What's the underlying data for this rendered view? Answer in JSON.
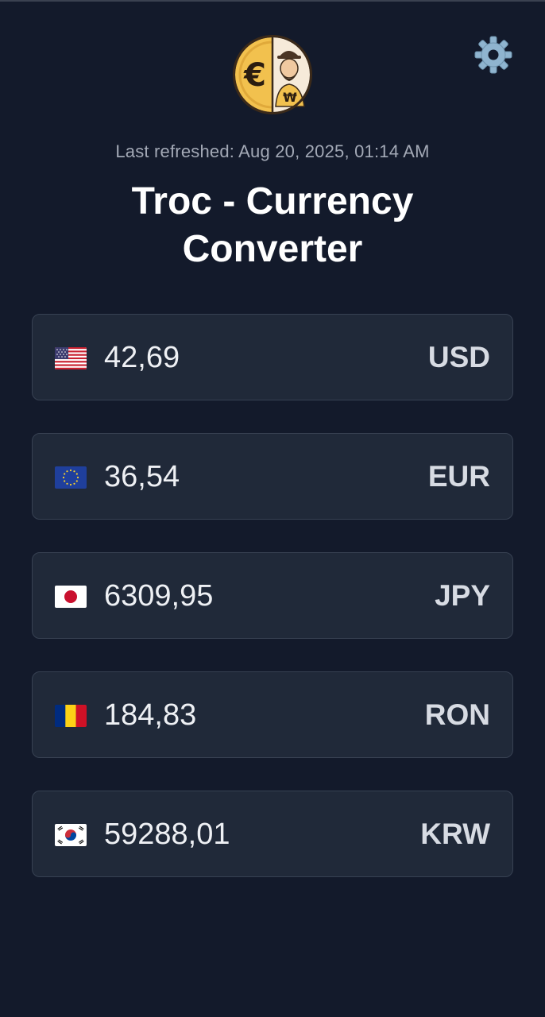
{
  "header": {
    "last_refreshed": "Last refreshed: Aug 20, 2025, 01:14 AM",
    "title": "Troc - Currency Converter",
    "logo_icon": "euro-won-coin-icon",
    "settings_icon": "gear-icon"
  },
  "currencies": [
    {
      "flag": "us-flag-icon",
      "amount": "42,69",
      "code": "USD"
    },
    {
      "flag": "eu-flag-icon",
      "amount": "36,54",
      "code": "EUR"
    },
    {
      "flag": "jp-flag-icon",
      "amount": "6309,95",
      "code": "JPY"
    },
    {
      "flag": "ro-flag-icon",
      "amount": "184,83",
      "code": "RON"
    },
    {
      "flag": "kr-flag-icon",
      "amount": "59288,01",
      "code": "KRW"
    }
  ],
  "colors": {
    "background": "#131a2b",
    "card": "#202939",
    "card_border": "#374152",
    "coin_gold": "#f2c14e",
    "gear": "#8fb4cf"
  }
}
